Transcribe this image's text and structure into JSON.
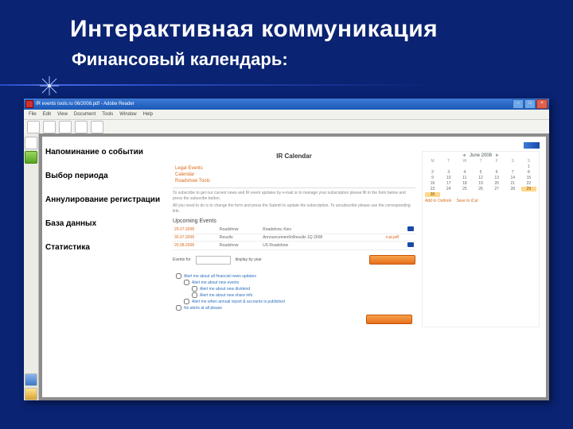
{
  "slide": {
    "title": "Интерактивная коммуникация",
    "subtitle": "Финансовый календарь:"
  },
  "window": {
    "title": "IR events tools.ru 06/2008.pdf - Adobe Reader",
    "menu": [
      "File",
      "Edit",
      "View",
      "Document",
      "Tools",
      "Window",
      "Help"
    ]
  },
  "callouts": {
    "c1": "Напоминание о событии",
    "c2": "Выбор периода",
    "c3": "Аннулирование регистрации",
    "c4": "База данных",
    "c5": "Статистика"
  },
  "page": {
    "irTitle": "IR Calendar",
    "links": {
      "l1": "Legal Events",
      "l2": "Calendar",
      "l3": "Roadshow Tools"
    },
    "body1": "To subscribe to get our current news and IR event updates by e-mail or to manage your subscription please fill in the form below and press the subscribe button.",
    "body2": "All you need to do is to change the form and press the Submit to update the subscription. To unsubscribe please use the corresponding link.",
    "subhead": "Upcoming Events",
    "events": {
      "rows": [
        {
          "date": "29.07.2008",
          "type": "Roadshow",
          "event": "Roadshow, Kiev",
          "reg": ""
        },
        {
          "date": "30.07.2008",
          "type": "Results",
          "event": "Announcement\\nResults 1Q 2008",
          "reg": "ical.pdf"
        },
        {
          "date": "20.08.2008",
          "type": "Roadshow",
          "event": "US Roadshow",
          "reg": ""
        }
      ]
    },
    "periodLabel": "Events for",
    "periodSel": "display by year",
    "checks": {
      "a": "Alert me about all financial news updates",
      "b": "Alert me about new events",
      "c": "Alert me about new dividend",
      "d": "Alert me about new share info",
      "e": "Alert me when annual report & accounts is published",
      "f": "No alerts at all please"
    }
  },
  "calendar": {
    "title": "June 2008",
    "dows": [
      "M",
      "T",
      "W",
      "T",
      "F",
      "S",
      "S"
    ],
    "days": [
      "",
      "",
      "",
      "",
      "",
      "",
      1,
      2,
      3,
      4,
      5,
      6,
      7,
      8,
      9,
      10,
      11,
      12,
      13,
      14,
      15,
      16,
      17,
      18,
      19,
      20,
      21,
      22,
      23,
      24,
      25,
      26,
      27,
      28,
      29,
      30,
      "",
      "",
      "",
      "",
      "",
      ""
    ],
    "highlight": [
      29,
      30
    ],
    "links": {
      "a": "Add to Outlook",
      "b": "Save to iCal"
    }
  }
}
